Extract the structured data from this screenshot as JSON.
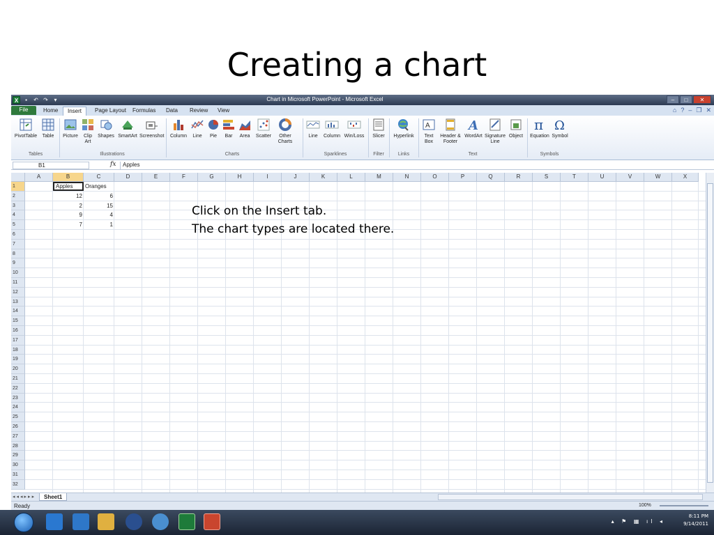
{
  "slide": {
    "title": "Creating a chart",
    "annotation_line1": "Click on the Insert tab.",
    "annotation_line2": "The chart types are located there."
  },
  "window": {
    "title": "Chart in Microsoft PowerPoint - Microsoft Excel"
  },
  "menu_tabs": [
    "File",
    "Home",
    "Insert",
    "Page Layout",
    "Formulas",
    "Data",
    "Review",
    "View"
  ],
  "active_tab": "Insert",
  "ribbon": {
    "tables": {
      "label": "Tables",
      "items": [
        "PivotTable",
        "Table"
      ]
    },
    "illustrations": {
      "label": "Illustrations",
      "items": [
        "Picture",
        "Clip Art",
        "Shapes",
        "SmartArt",
        "Screenshot"
      ]
    },
    "charts": {
      "label": "Charts",
      "items": [
        "Column",
        "Line",
        "Pie",
        "Bar",
        "Area",
        "Scatter",
        "Other Charts"
      ]
    },
    "sparklines": {
      "label": "Sparklines",
      "items": [
        "Line",
        "Column",
        "Win/Loss"
      ]
    },
    "filter": {
      "label": "Filter",
      "items": [
        "Slicer"
      ]
    },
    "links": {
      "label": "Links",
      "items": [
        "Hyperlink"
      ]
    },
    "text": {
      "label": "Text",
      "items": [
        "Text Box",
        "Header & Footer",
        "WordArt",
        "Signature Line",
        "Object"
      ]
    },
    "symbols": {
      "label": "Symbols",
      "items": [
        "Equation",
        "Symbol"
      ]
    }
  },
  "formula_bar": {
    "name_box": "B1",
    "fx_label": "fx",
    "value": "Apples"
  },
  "columns": [
    "A",
    "B",
    "C",
    "D",
    "E",
    "F",
    "G",
    "H",
    "I",
    "J",
    "K",
    "L",
    "M",
    "N",
    "O",
    "P",
    "Q",
    "R",
    "S",
    "T",
    "U",
    "V",
    "W",
    "X"
  ],
  "rows": [
    "1",
    "2",
    "3",
    "4",
    "5",
    "6",
    "7",
    "8",
    "9",
    "10",
    "11",
    "12",
    "13",
    "14",
    "15",
    "16",
    "17",
    "18",
    "19",
    "20",
    "21",
    "22",
    "23",
    "24",
    "25",
    "26",
    "27",
    "28",
    "29",
    "30",
    "31",
    "32"
  ],
  "cells": {
    "B1": "Apples",
    "C1": "Oranges",
    "B2": "12",
    "C2": "6",
    "B3": "2",
    "C3": "15",
    "B4": "9",
    "C4": "4",
    "B5": "7",
    "C5": "1"
  },
  "sheet_tab": "Sheet1",
  "status": "Ready",
  "zoom": "100%",
  "clock": {
    "time": "8:11 PM",
    "date": "9/14/2011"
  }
}
